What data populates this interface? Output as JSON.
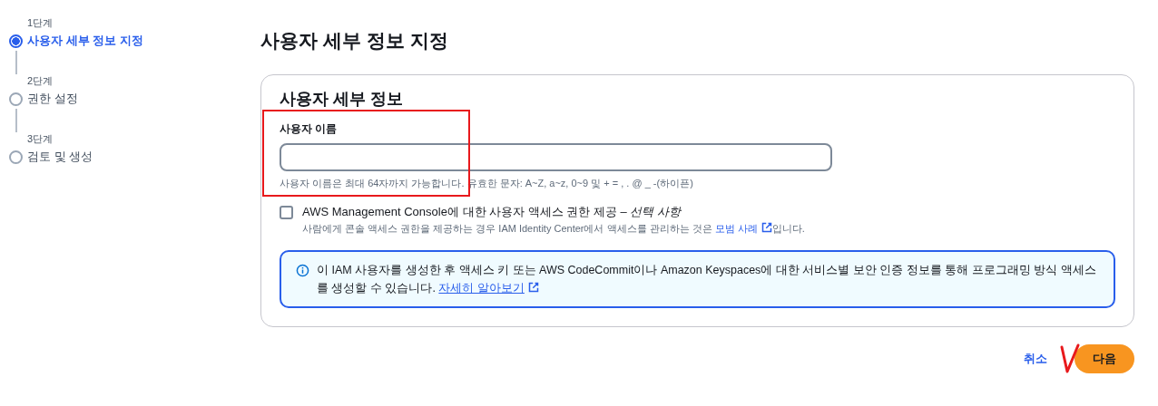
{
  "steps": [
    {
      "step": "1단계",
      "label": "사용자 세부 정보 지정",
      "selected": true
    },
    {
      "step": "2단계",
      "label": "권한 설정",
      "selected": false
    },
    {
      "step": "3단계",
      "label": "검토 및 생성",
      "selected": false
    }
  ],
  "page_title": "사용자 세부 정보 지정",
  "card": {
    "title": "사용자 세부 정보",
    "username_field": {
      "label": "사용자 이름",
      "hint": "사용자 이름은 최대 64자까지 가능합니다. 유효한 문자: A~Z, a~z, 0~9 및 + = , . @ _ -(하이픈)"
    },
    "console_access": {
      "checked": false,
      "label": "AWS Management Console에 대한 사용자 액세스 권한 제공 – *선택 사항*",
      "description_before": "사람에게 콘솔 액세스 권한을 제공하는 경우 IAM Identity Center에서 액세스를 관리하는 것은 ",
      "description_link": "모범 사례",
      "description_after": "입니다."
    },
    "info": {
      "text": "이 IAM 사용자를 생성한 후 액세스 키 또는 AWS CodeCommit이나 Amazon Keyspaces에 대한 서비스별 보안 인증 정보를 통해 프로그래밍 방식 액세스를 생성할 수 있습니다. ",
      "link": "자세히 알아보기"
    }
  },
  "buttons": [
    {
      "kind": "link",
      "label": "취소"
    },
    {
      "kind": "primary",
      "label": "다음"
    }
  ]
}
